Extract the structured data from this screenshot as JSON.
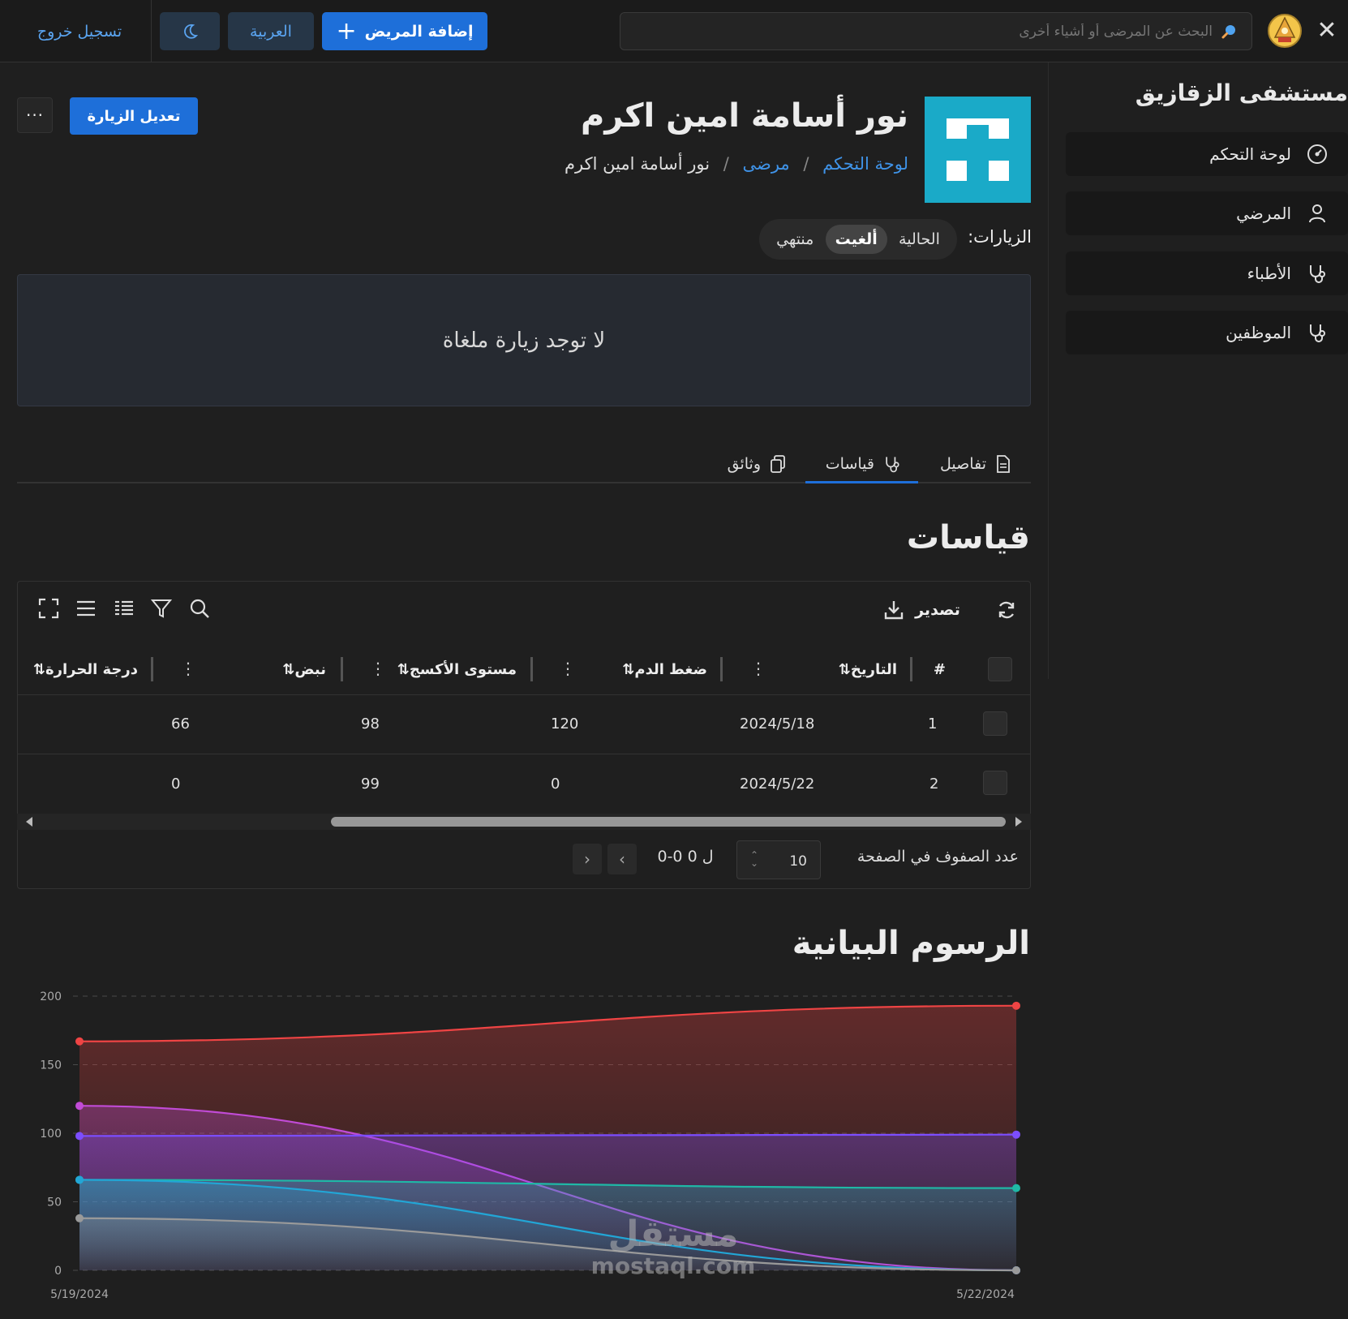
{
  "topbar": {
    "search_placeholder": "البحث عن المرضى أو أشياء أخرى",
    "add_patient": "إضافة المريض",
    "language": "العربية",
    "logout": "تسجيل خروج"
  },
  "sidebar": {
    "title": "مستشفى الزقازيق",
    "items": [
      {
        "label": "لوحة التحكم",
        "icon": "dashboard-gauge-icon"
      },
      {
        "label": "المرضي",
        "icon": "user-icon"
      },
      {
        "label": "الأطباء",
        "icon": "stethoscope-icon"
      },
      {
        "label": "الموظفين",
        "icon": "stethoscope-icon"
      }
    ]
  },
  "header": {
    "patient_name": "نور أسامة امين اكرم",
    "breadcrumb": [
      "لوحة التحكم",
      "مرضى",
      "نور أسامة امين اكرم"
    ],
    "breadcrumb_sep": "/",
    "edit_visit": "تعديل الزيارة",
    "more": "···"
  },
  "visits": {
    "label": "الزيارات:",
    "options": [
      "الحالية",
      "ألغيت",
      "منتهي"
    ],
    "selected": "ألغيت",
    "empty_message": "لا توجد زيارة ملغاة"
  },
  "tabs": [
    {
      "label": "تفاصيل",
      "icon": "document-icon"
    },
    {
      "label": "قياسات",
      "icon": "stethoscope-icon",
      "active": true
    },
    {
      "label": "وثائق",
      "icon": "copy-icon"
    }
  ],
  "measurements": {
    "title": "قياسات",
    "export": "تصدير",
    "columns": [
      "#",
      "التاريخ",
      "ضغط الدم",
      "مستوى الأكسج",
      "نبض",
      "درجة الحرارة"
    ],
    "sort_glyph": "⇅",
    "rows": [
      {
        "num": "1",
        "date": "2024/5/18",
        "bp": "120",
        "oxygen": "98",
        "pulse": "66",
        "temp": ""
      },
      {
        "num": "2",
        "date": "2024/5/22",
        "bp": "0",
        "oxygen": "99",
        "pulse": "0",
        "temp": ""
      }
    ],
    "pagination": {
      "rows_per_page_label": "عدد الصفوف في الصفحة",
      "rows_per_page": "10",
      "range": "0-0 ل 0"
    }
  },
  "charts": {
    "title": "الرسوم البيانية",
    "watermark_ar": "مستقل",
    "watermark_en": "mostaql.com"
  },
  "chart_data": {
    "type": "area",
    "x": [
      "5/19/2024",
      "5/22/2024"
    ],
    "ylim": [
      0,
      200
    ],
    "yticks": [
      0,
      50,
      100,
      150,
      200
    ],
    "grid": true,
    "series": [
      {
        "color": "#ef4444",
        "values": [
          167,
          193
        ]
      },
      {
        "color": "#c14bd6",
        "values": [
          120,
          0
        ]
      },
      {
        "color": "#7c4dff",
        "values": [
          98,
          99
        ]
      },
      {
        "color": "#1fb8a6",
        "values": [
          66,
          60
        ]
      },
      {
        "color": "#22a6d6",
        "values": [
          66,
          0
        ]
      },
      {
        "color": "#9a9a9a",
        "values": [
          38,
          0
        ]
      }
    ]
  },
  "colors": {
    "accent": "#1e6fd9",
    "link": "#3f93e8",
    "avatar": "#1aaac8",
    "background": "#1f1f1f"
  }
}
